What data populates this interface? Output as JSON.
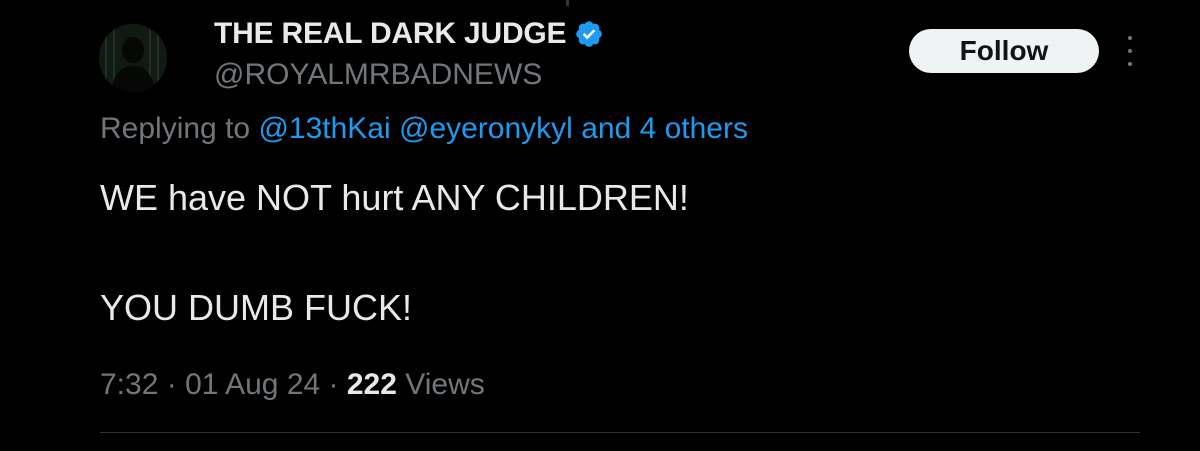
{
  "author": {
    "display_name": "THE REAL DARK JUDGE",
    "handle": "@ROYALMRBADNEWS",
    "verified": true,
    "verified_icon": "verified-badge-icon"
  },
  "actions": {
    "follow_label": "Follow",
    "more_icon": "more-vertical-icon"
  },
  "reply": {
    "prefix": "Replying to",
    "mention_1": "@13thKai",
    "mention_2": "@eyeronykyl",
    "others": "and 4 others"
  },
  "post": {
    "line_1": "WE have NOT hurt ANY CHILDREN!",
    "line_2": "YOU DUMB FUCK!"
  },
  "meta": {
    "time": "7:32",
    "sep_1": " · ",
    "date": "01 Aug 24",
    "sep_2": " · ",
    "views_count": "222",
    "views_label": "Views"
  },
  "colors": {
    "background": "#000000",
    "text_primary": "#e7e9ea",
    "text_secondary": "#71767b",
    "link": "#1d9bf0",
    "verified": "#1d9bf0"
  }
}
